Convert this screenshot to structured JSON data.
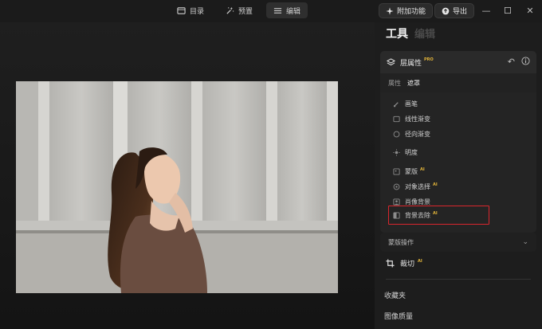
{
  "topbar": {
    "nav": [
      {
        "label": "目录",
        "icon": "catalog-icon"
      },
      {
        "label": "预置",
        "icon": "presets-icon"
      },
      {
        "label": "编辑",
        "icon": "sliders-icon"
      }
    ],
    "addons_label": "附加功能",
    "export_label": "导出"
  },
  "panel": {
    "tab_tools": "工具",
    "tab_edit": "编辑",
    "layer": {
      "title": "层属性",
      "badge": "PRO"
    },
    "subtabs": [
      "属性",
      "遮罩"
    ],
    "tools": [
      {
        "label": "画笔",
        "icon": "brush-icon",
        "ai": ""
      },
      {
        "label": "线性渐变",
        "icon": "linear-gradient-icon",
        "ai": ""
      },
      {
        "label": "径向渐变",
        "icon": "radial-gradient-icon",
        "ai": ""
      },
      {
        "label": "明度",
        "icon": "luminance-icon",
        "ai": ""
      },
      {
        "label": "蒙版",
        "icon": "mask-icon",
        "ai": "AI"
      },
      {
        "label": "对象选择",
        "icon": "object-select-icon",
        "ai": "AI"
      },
      {
        "label": "肖像背景",
        "icon": "portrait-bg-icon",
        "ai": ""
      },
      {
        "label": "背景去除",
        "icon": "bg-remove-icon",
        "ai": "AI"
      }
    ],
    "mask_ops": "蒙版操作",
    "crop": {
      "label": "裁切",
      "ai": "AI"
    },
    "sections": [
      "收藏夹",
      "图像质量"
    ]
  }
}
